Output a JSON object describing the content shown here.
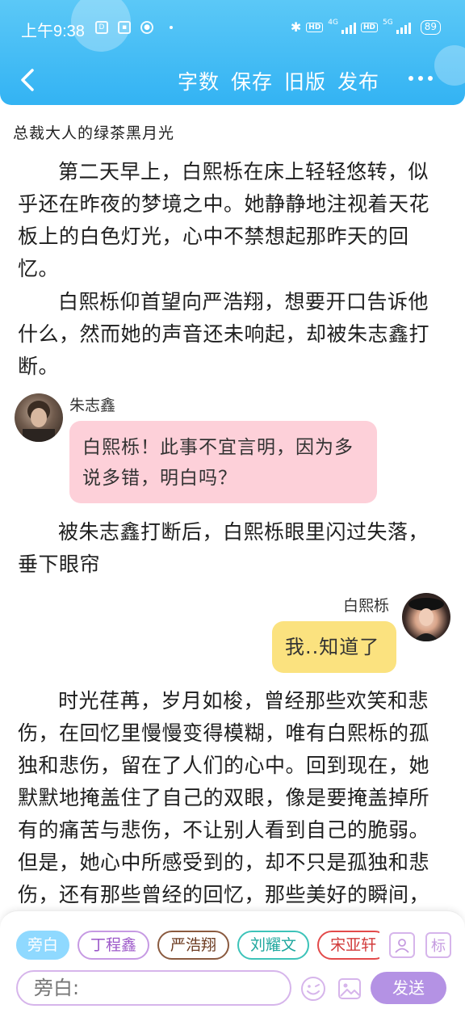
{
  "status_bar": {
    "time": "上午9:38",
    "network_gen_1": "4G",
    "network_gen_2": "5G",
    "hd_label": "HD",
    "battery": "89"
  },
  "toolbar": {
    "actions": [
      "字数",
      "保存",
      "旧版",
      "发布"
    ]
  },
  "document": {
    "title": "总裁大人的绿茶黑月光",
    "paragraphs": [
      "第二天早上，白熙栎在床上轻轻悠转，似乎还在昨夜的梦境之中。她静静地注视着天花板上的白色灯光，心中不禁想起那昨天的回忆。",
      "白熙栎仰首望向严浩翔，想要开口告诉他什么，然而她的声音还未响起，却被朱志鑫打断。",
      "被朱志鑫打断后，白熙栎眼里闪过失落，垂下眼帘",
      "时光荏苒，岁月如梭，曾经那些欢笑和悲伤，在回忆里慢慢变得模糊，唯有白熙栎的孤独和悲伤，留在了人们的心中。回到现在，她默默地掩盖住了自己的双眼，像是要掩盖掉所有的痛苦与悲伤，不让别人看到自己的脆弱。但是，她心中所感受到的，却不只是孤独和悲伤，还有那些曾经的回忆，那些美好的瞬间，在此刻仿佛也变得无关紧要"
    ]
  },
  "dialogues": [
    {
      "speaker": "朱志鑫",
      "text": "白熙栎！此事不宜言明，因为多说多错，明白吗？",
      "side": "left",
      "color": "#fdd0d9"
    },
    {
      "speaker": "白熙栎",
      "text": "我..知道了",
      "side": "right",
      "color": "#fbe27f"
    }
  ],
  "composer": {
    "roles": [
      "旁白",
      "丁程鑫",
      "严浩翔",
      "刘耀文",
      "宋亚轩"
    ],
    "input_placeholder": "旁白:",
    "send_label": "发送",
    "tag_label": "标"
  }
}
